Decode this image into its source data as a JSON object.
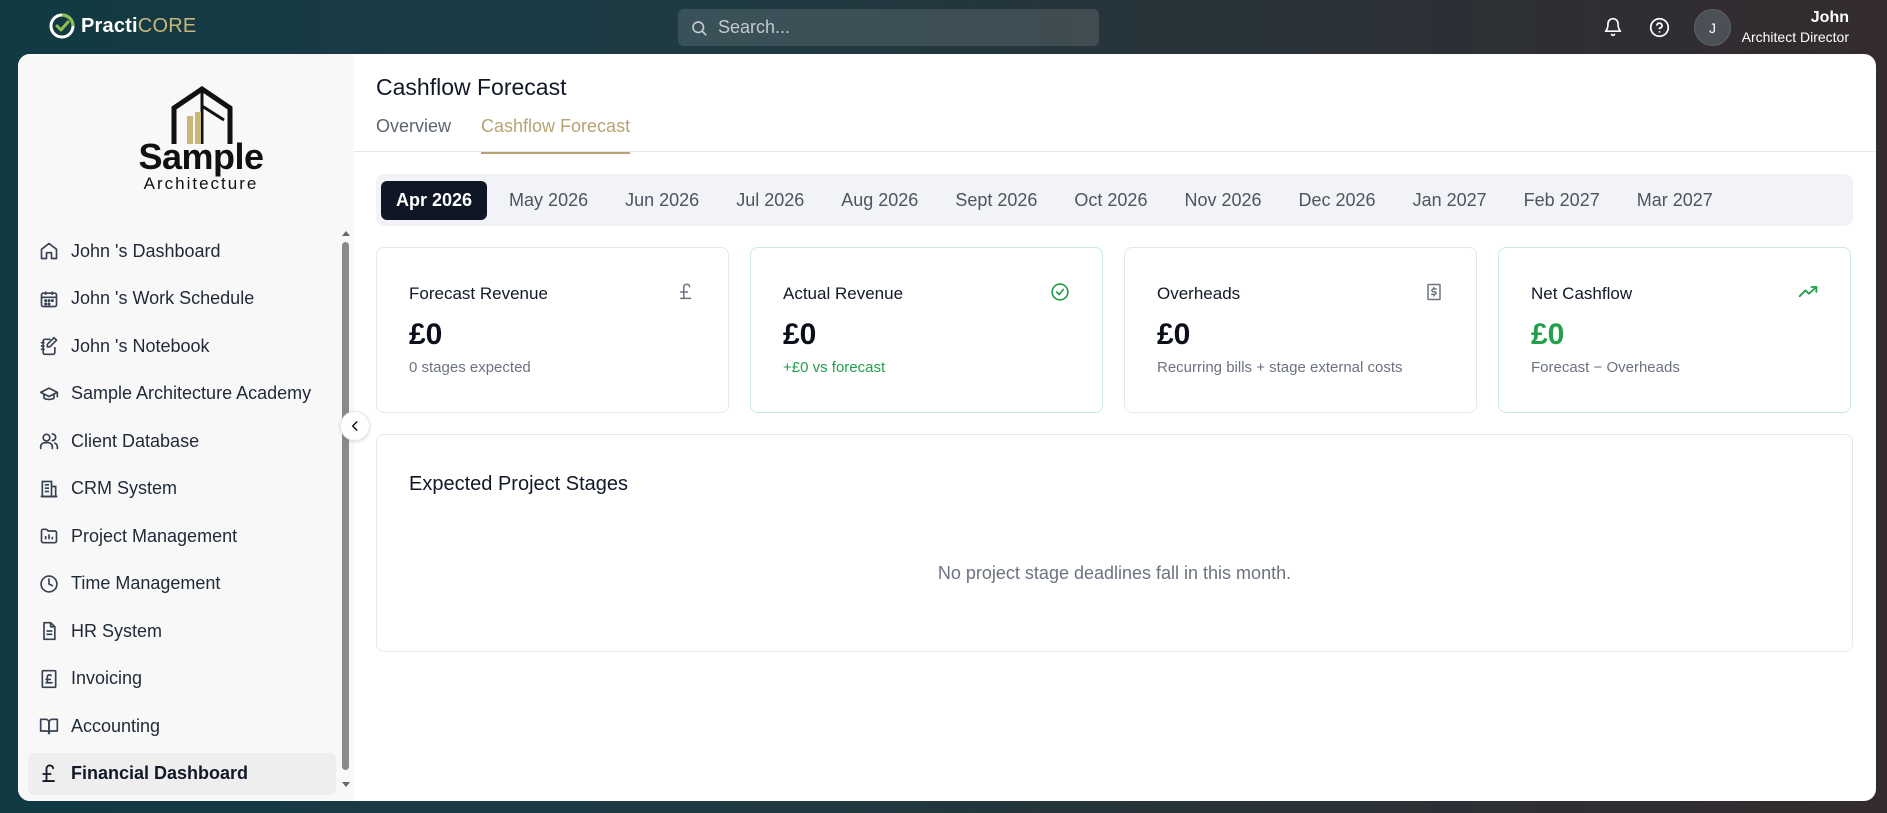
{
  "app": {
    "name_part1": "Practi",
    "name_part2": "CORE"
  },
  "search": {
    "placeholder": "Search..."
  },
  "user": {
    "initial": "J",
    "name": "John",
    "role": "Architect Director"
  },
  "brand": {
    "title": "Sample",
    "subtitle": "Architecture"
  },
  "sidebar": {
    "items": [
      {
        "label": "John 's Dashboard",
        "icon": "home-icon"
      },
      {
        "label": "John 's Work Schedule",
        "icon": "calendar-icon"
      },
      {
        "label": "John 's Notebook",
        "icon": "notebook-icon"
      },
      {
        "label": "Sample Architecture Academy",
        "icon": "graduation-cap-icon"
      },
      {
        "label": "Client Database",
        "icon": "users-icon"
      },
      {
        "label": "CRM System",
        "icon": "building-icon"
      },
      {
        "label": "Project Management",
        "icon": "folder-chart-icon"
      },
      {
        "label": "Time Management",
        "icon": "clock-icon"
      },
      {
        "label": "HR System",
        "icon": "document-icon"
      },
      {
        "label": "Invoicing",
        "icon": "pound-receipt-icon"
      },
      {
        "label": "Accounting",
        "icon": "book-icon"
      },
      {
        "label": "Financial Dashboard",
        "icon": "pound-icon",
        "active": true
      }
    ]
  },
  "page": {
    "title": "Cashflow Forecast"
  },
  "tabs": [
    {
      "label": "Overview"
    },
    {
      "label": "Cashflow Forecast",
      "active": true
    }
  ],
  "months": [
    "Apr 2026",
    "May 2026",
    "Jun 2026",
    "Jul 2026",
    "Aug 2026",
    "Sept 2026",
    "Oct 2026",
    "Nov 2026",
    "Dec 2026",
    "Jan 2027",
    "Feb 2027",
    "Mar 2027"
  ],
  "selected_month": "Apr 2026",
  "cards": [
    {
      "title": "Forecast Revenue",
      "value": "£0",
      "sub": "0 stages expected",
      "icon": "pound-icon"
    },
    {
      "title": "Actual Revenue",
      "value": "£0",
      "sub": "+£0 vs forecast",
      "icon": "check-circle-icon"
    },
    {
      "title": "Overheads",
      "value": "£0",
      "sub": "Recurring bills + stage external costs",
      "icon": "dollar-receipt-icon"
    },
    {
      "title": "Net Cashflow",
      "value": "£0",
      "sub": "Forecast − Overheads",
      "icon": "trending-up-icon"
    }
  ],
  "stages": {
    "title": "Expected Project Stages",
    "empty_message": "No project stage deadlines fall in this month."
  },
  "colors": {
    "accent": "#b8a271",
    "positive": "#22a04b",
    "active_month_bg": "#0f1726"
  }
}
